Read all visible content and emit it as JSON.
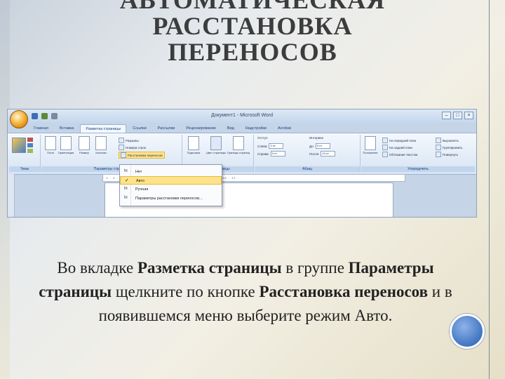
{
  "slide": {
    "title_lines": [
      "АВТОМАТИЧЕСКАЯ",
      "РАССТАНОВКА",
      "ПЕРЕНОСОВ"
    ],
    "body": {
      "p1": "Во вкладке ",
      "b1": "Разметка страницы",
      "p2": " в группе ",
      "b2": "Параметры страницы",
      "p3": " щелкните по кнопке ",
      "b3": "Расстановка переносов",
      "p4": " и в появившемся меню выберите режим Авто."
    }
  },
  "word": {
    "window_title": "Документ1 - Microsoft Word",
    "tabs": [
      "Главная",
      "Вставка",
      "Разметка страницы",
      "Ссылки",
      "Рассылки",
      "Рецензирование",
      "Вид",
      "Надстройки",
      "Acrobat"
    ],
    "active_tab_index": 2,
    "groups": {
      "themes": "Темы",
      "page_setup": "Параметры страницы",
      "page_background": "Фон страницы",
      "paragraph": "Абзац",
      "arrange": "Упорядочить"
    },
    "buttons": {
      "fields": "Поля",
      "orientation": "Ориентация",
      "size": "Размер",
      "columns": "Колонки",
      "breaks": "Разрывы",
      "line_numbers": "Номера строк",
      "hyphenation": "Расстановка переносов",
      "watermark": "Подложка",
      "page_color": "Цвет страницы",
      "page_borders": "Границы страниц",
      "indent": "Отступ",
      "spacing": "Интервал",
      "left": "Слева:",
      "right": "Справа:",
      "before": "До:",
      "after": "После:",
      "indent_left_value": "0 пт",
      "indent_right_value": "0 пт",
      "spacing_before_value": "0 пт",
      "spacing_after_value": "10 пт",
      "position": "Положение",
      "front": "На передний план",
      "back": "На задний план",
      "wrap": "Обтекание текстом",
      "align": "Выровнять",
      "group": "Группировать",
      "rotate": "Повернуть"
    },
    "hyphen_menu": {
      "items": [
        "Нет",
        "Авто",
        "Ручная",
        "Параметры расстановки переносов..."
      ],
      "selected_index": 1
    },
    "ruler_text": "· 1 · 2 · 3 · 4 · 5 · 6 · 7 · 8 · 9 · 10 · 11 · 12 · 13 · 14 · 15 · 16 · 17 ·"
  },
  "colors": {
    "accent_circle": "#4b7ec7",
    "menu_highlight": "#fde38a",
    "title": "#3c3c3c"
  }
}
